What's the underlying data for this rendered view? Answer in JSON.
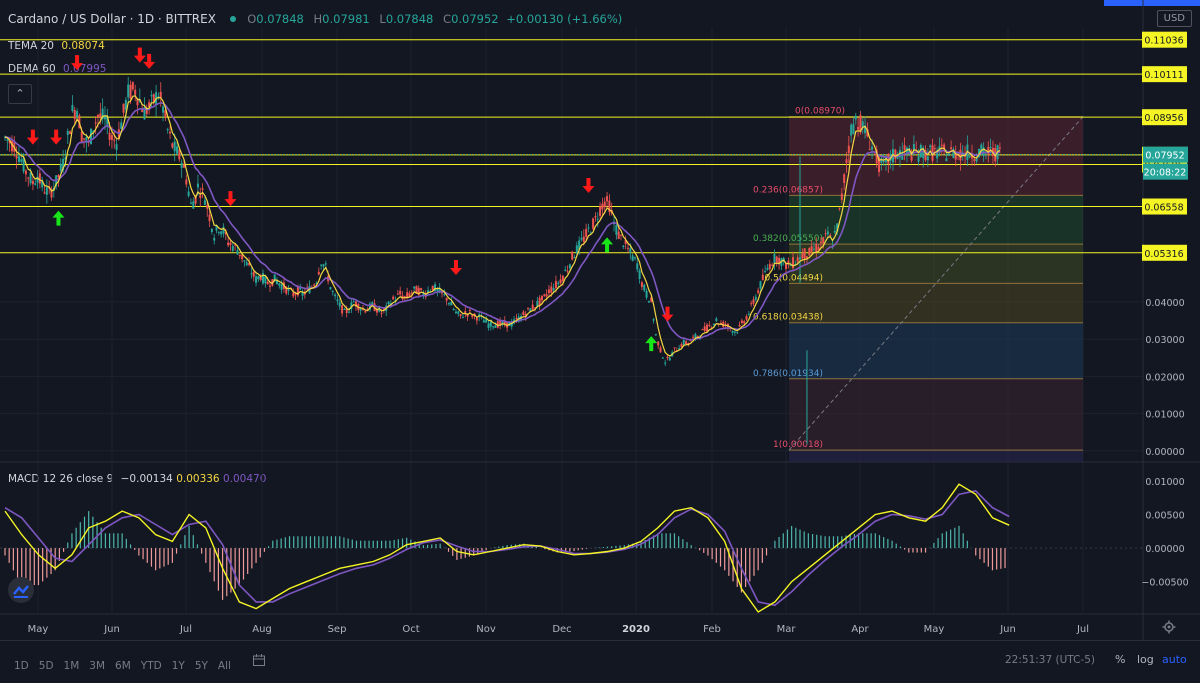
{
  "header": {
    "symbol": "Cardano / US Dollar · 1D · BITTREX",
    "o_label": "O",
    "o": "0.07848",
    "h_label": "H",
    "h": "0.07981",
    "l_label": "L",
    "l": "0.07848",
    "c_label": "C",
    "c": "0.07952",
    "change": "+0.00130 (+1.66%)"
  },
  "indicators": {
    "tema_label": "TEMA 20",
    "tema_value": "0.08074",
    "dema_label": "DEMA 60",
    "dema_value": "0.07995",
    "macd_label": "MACD 12 26 close 9",
    "macd_v1": "−0.00134",
    "macd_v2": "0.00336",
    "macd_v3": "0.00470"
  },
  "currency_button": "USD",
  "collapse_icon": "chevron-up-icon",
  "timeframes": [
    "1D",
    "5D",
    "1M",
    "3M",
    "6M",
    "YTD",
    "1Y",
    "5Y",
    "All"
  ],
  "clock": "22:51:37 (UTC-5)",
  "bottom_right": {
    "percent": "%",
    "log": "log",
    "auto": "auto"
  },
  "colors": {
    "background": "#131722",
    "up": "#26a69a",
    "down": "#ef5350",
    "tema": "#f5d742",
    "dema": "#7e57c2",
    "hline": "#f5f525",
    "arrow_down": "#ff1a1a",
    "arrow_up": "#19e619",
    "macd_signal": "#7e57c2",
    "macd_line": "#f5f525"
  },
  "chart_data": [
    {
      "type": "candlestick",
      "title": "Cardano / US Dollar · 1D · BITTREX",
      "x_ticks": [
        "May",
        "Jun",
        "Jul",
        "Aug",
        "Sep",
        "Oct",
        "Nov",
        "Dec",
        "2020",
        "Feb",
        "Mar",
        "Apr",
        "May",
        "Jun",
        "Jul"
      ],
      "y_ticks": [
        "0.04000",
        "0.03000",
        "0.02000",
        "0.01000",
        "0.00000"
      ],
      "y_range": [
        -0.003,
        0.1135
      ],
      "price_path": {
        "t": [
          0,
          4,
          7,
          9,
          12,
          14,
          16,
          19,
          22,
          25,
          29,
          31,
          33,
          36,
          38,
          40,
          43,
          46,
          48,
          50,
          53,
          56,
          58,
          60,
          63,
          66,
          68,
          70,
          72,
          74,
          76,
          78,
          80,
          82,
          83,
          84,
          86,
          88,
          90,
          92,
          94,
          96,
          98,
          100,
          102,
          104,
          106,
          108,
          110,
          113,
          116,
          118,
          120,
          122,
          124,
          126,
          128,
          130,
          132,
          134,
          136,
          138,
          140,
          142,
          144,
          146,
          148,
          150,
          152,
          154,
          156,
          158,
          160,
          162,
          164,
          166,
          168,
          170,
          172,
          174,
          176,
          178,
          180,
          182,
          184,
          186,
          188,
          190,
          192,
          194,
          196,
          198,
          200,
          202,
          204,
          206,
          208,
          210,
          212,
          214,
          216,
          218,
          220,
          222,
          224,
          226,
          228,
          230,
          232,
          234,
          236,
          238,
          240,
          242,
          244,
          246,
          248,
          250,
          252,
          254,
          256,
          258,
          260,
          262,
          264,
          266,
          268,
          270,
          272,
          274,
          276,
          278,
          280,
          282,
          284,
          286,
          288,
          290,
          292,
          294,
          296,
          298,
          300,
          302,
          304,
          306,
          308,
          310,
          312,
          314,
          316,
          318,
          320,
          322,
          324,
          326,
          328,
          330,
          332,
          334,
          336,
          338,
          340,
          342,
          344,
          346,
          348,
          350,
          352,
          354,
          356,
          358,
          360,
          362,
          364,
          366,
          368,
          370,
          372,
          374,
          376,
          378,
          380,
          382,
          384,
          386,
          388,
          390,
          392,
          394,
          396,
          398,
          400,
          402,
          404,
          406,
          408,
          410,
          412,
          414,
          416,
          418,
          420,
          422,
          424,
          426,
          428,
          430,
          432,
          434,
          436,
          438,
          440,
          442,
          444,
          446,
          448,
          450,
          452,
          454,
          456
        ],
        "v": [
          0.084,
          0.082,
          0.078,
          0.075,
          0.072,
          0.074,
          0.071,
          0.069,
          0.072,
          0.077,
          0.091,
          0.092,
          0.085,
          0.082,
          0.087,
          0.09,
          0.089,
          0.084,
          0.083,
          0.088,
          0.096,
          0.097,
          0.094,
          0.091,
          0.093,
          0.096,
          0.092,
          0.086,
          0.082,
          0.08,
          0.078,
          0.073,
          0.066,
          0.068,
          0.071,
          0.07,
          0.068,
          0.063,
          0.058,
          0.06,
          0.059,
          0.056,
          0.055,
          0.054,
          0.052,
          0.05,
          0.048,
          0.046,
          0.047,
          0.045,
          0.046,
          0.045,
          0.044,
          0.043,
          0.042,
          0.043,
          0.042,
          0.043,
          0.044,
          0.046,
          0.051,
          0.049,
          0.044,
          0.041,
          0.039,
          0.037,
          0.038,
          0.04,
          0.039,
          0.038,
          0.038,
          0.039,
          0.038,
          0.037,
          0.038,
          0.04,
          0.041,
          0.042,
          0.041,
          0.042,
          0.043,
          0.043,
          0.042,
          0.043,
          0.044,
          0.043,
          0.042,
          0.041,
          0.039,
          0.037,
          0.036,
          0.037,
          0.037,
          0.036,
          0.036,
          0.035,
          0.034,
          0.034,
          0.034,
          0.034,
          0.034,
          0.034,
          0.035,
          0.036,
          0.037,
          0.038,
          0.039,
          0.04,
          0.041,
          0.043,
          0.044,
          0.045,
          0.047,
          0.049,
          0.052,
          0.054,
          0.056,
          0.058,
          0.06,
          0.062,
          0.065,
          0.067,
          0.066,
          0.061,
          0.058,
          0.056,
          0.054,
          0.052,
          0.05,
          0.045,
          0.042,
          0.04,
          0.031,
          0.027,
          0.024,
          0.025,
          0.027,
          0.028,
          0.029,
          0.029,
          0.03,
          0.031,
          0.032,
          0.033,
          0.034,
          0.035,
          0.034,
          0.034,
          0.033,
          0.032,
          0.033,
          0.035,
          0.037,
          0.04,
          0.043,
          0.046,
          0.049,
          0.051,
          0.052,
          0.051,
          0.05,
          0.05,
          0.051,
          0.052,
          0.053,
          0.053,
          0.054,
          0.055,
          0.056,
          0.058,
          0.056,
          0.06,
          0.068,
          0.078,
          0.086,
          0.089,
          0.088,
          0.086,
          0.083,
          0.08,
          0.077,
          0.076,
          0.078,
          0.079,
          0.08,
          0.08,
          0.08,
          0.08,
          0.08,
          0.08,
          0.08,
          0.08,
          0.08,
          0.08,
          0.08,
          0.08,
          0.08,
          0.08,
          0.08,
          0.08,
          0.08,
          0.08,
          0.08,
          0.08,
          0.08,
          0.08,
          0.08,
          0.08,
          0.08,
          0.08,
          0.08,
          0.08,
          0.08,
          0.08,
          0.08,
          0.08,
          0.08,
          0.08,
          0.08,
          0.08,
          0.08,
          0.08,
          0.08,
          0.08,
          0.08,
          0.08,
          0.08,
          0.08,
          0.08
        ]
      },
      "horizontal_levels": [
        {
          "price": "0.11036",
          "v": 0.11036
        },
        {
          "price": "0.10111",
          "v": 0.10111
        },
        {
          "price": "0.08956",
          "v": 0.08956
        },
        {
          "price": "0.07945",
          "v": 0.07945
        },
        {
          "price": "0.07685",
          "v": 0.07685
        },
        {
          "price": "0.06558",
          "v": 0.06558
        },
        {
          "price": "0.05316",
          "v": 0.05316
        }
      ],
      "last_price_label": "0.07952",
      "countdown_label": "20:08:22",
      "fibonacci": {
        "levels": [
          {
            "label": "0(0.08970)",
            "v": 0.0897,
            "fill": "#5b2432"
          },
          {
            "label": "0.236(0.06857)",
            "v": 0.06857,
            "fill": "#214a2e"
          },
          {
            "label": "0.382(0.05550)",
            "v": 0.0555,
            "fill": "#3f4a24"
          },
          {
            "label": "0.5(0.04494)",
            "v": 0.04494,
            "fill": "#4d4520"
          },
          {
            "label": "0.618(0.03438)",
            "v": 0.03438,
            "fill": "#1e3b5a"
          },
          {
            "label": "0.786(0.01934)",
            "v": 0.01934,
            "fill": "#3a2432"
          },
          {
            "label": "1(0.00018)",
            "v": 0.00018,
            "fill": "#2a2450"
          }
        ]
      },
      "signals_down": [
        12,
        22,
        31,
        58,
        62,
        97,
        194,
        251,
        285
      ],
      "signals_up": [
        23,
        259,
        278
      ]
    },
    {
      "type": "line",
      "title": "MACD 12 26 close 9",
      "y_ticks": [
        "0.01000",
        "0.00500",
        "0.00000",
        "−0.00500"
      ],
      "y_range": [
        -0.0095,
        0.0125
      ],
      "series": [
        {
          "name": "MACD",
          "color": "#f5f525",
          "values": [
            0.0055,
            0.002,
            -0.001,
            -0.003,
            -0.001,
            0.003,
            0.004,
            0.0055,
            0.0045,
            0.002,
            0.001,
            0.005,
            0.003,
            -0.003,
            -0.008,
            -0.009,
            -0.0075,
            -0.006,
            -0.005,
            -0.004,
            -0.003,
            -0.0025,
            -0.002,
            -0.001,
            0.0005,
            0.001,
            0.0015,
            -0.0005,
            -0.001,
            -0.0005,
            0.0,
            0.0005,
            0.0003,
            -0.0005,
            -0.001,
            -0.0008,
            -0.0005,
            0.0,
            0.001,
            0.003,
            0.0055,
            0.006,
            0.0045,
            0.001,
            -0.006,
            -0.0095,
            -0.008,
            -0.005,
            -0.003,
            -0.001,
            0.001,
            0.003,
            0.005,
            0.0055,
            0.0045,
            0.004,
            0.006,
            0.0095,
            0.008,
            0.0045,
            0.0034
          ]
        },
        {
          "name": "Signal",
          "color": "#7e57c2",
          "values": [
            0.006,
            0.0045,
            0.0015,
            -0.0015,
            -0.002,
            0.0005,
            0.003,
            0.0045,
            0.005,
            0.0035,
            0.002,
            0.0035,
            0.004,
            0.0005,
            -0.0055,
            -0.008,
            -0.008,
            -0.0068,
            -0.0058,
            -0.0048,
            -0.0038,
            -0.003,
            -0.0025,
            -0.0015,
            -0.0002,
            0.0008,
            0.0012,
            0.0003,
            -0.0005,
            -0.0005,
            -0.0002,
            0.0002,
            0.0003,
            -0.0002,
            -0.0008,
            -0.0008,
            -0.0006,
            -0.0002,
            0.0006,
            0.002,
            0.0045,
            0.0058,
            0.005,
            0.0025,
            -0.003,
            -0.008,
            -0.0085,
            -0.0065,
            -0.004,
            -0.0018,
            0.0002,
            0.002,
            0.004,
            0.005,
            0.0048,
            0.0043,
            0.005,
            0.008,
            0.0085,
            0.006,
            0.0047
          ]
        }
      ]
    }
  ]
}
